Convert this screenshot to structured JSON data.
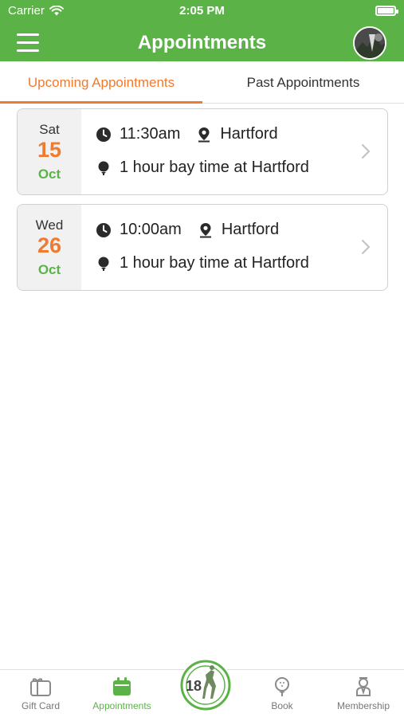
{
  "status_bar": {
    "carrier": "Carrier",
    "time": "2:05 PM"
  },
  "nav": {
    "title": "Appointments"
  },
  "tabs": [
    {
      "label": "Upcoming Appointments",
      "active": true
    },
    {
      "label": "Past Appointments",
      "active": false
    }
  ],
  "appointments": [
    {
      "day_of_week": "Sat",
      "day": "15",
      "month": "Oct",
      "time": "11:30am",
      "location": "Hartford",
      "description": "1 hour bay time at Hartford"
    },
    {
      "day_of_week": "Wed",
      "day": "26",
      "month": "Oct",
      "time": "10:00am",
      "location": "Hartford",
      "description": "1 hour bay time at Hartford"
    }
  ],
  "tab_bar": {
    "items": [
      {
        "label": "Gift Card",
        "icon": "gift-card-icon"
      },
      {
        "label": "Appointments",
        "icon": "calendar-icon",
        "active": true
      },
      {
        "label": "Book",
        "icon": "golf-ball-tee-icon"
      },
      {
        "label": "Membership",
        "icon": "membership-icon"
      }
    ],
    "center_logo_text": "18"
  },
  "colors": {
    "brand_green": "#5bb347",
    "accent_orange": "#ee7b30"
  }
}
